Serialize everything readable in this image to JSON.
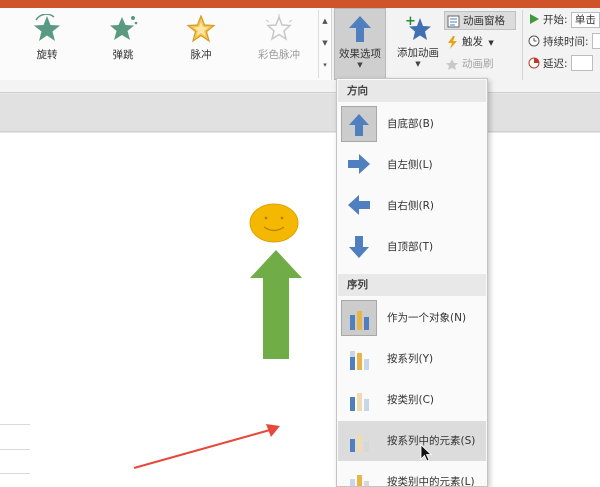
{
  "animations_gallery": [
    {
      "label": "旋转",
      "icon": "spin-star-icon"
    },
    {
      "label": "弹跳",
      "icon": "bounce-star-icon"
    },
    {
      "label": "脉冲",
      "icon": "pulse-star-icon"
    },
    {
      "label": "彩色脉冲",
      "icon": "color-pulse-star-icon"
    }
  ],
  "ribbon": {
    "effect_options_label": "效果选项",
    "add_animation_label": "添加动画",
    "animation_pane_label": "动画窗格",
    "trigger_label": "触发",
    "animation_painter_label": "动画刷",
    "start_label": "开始:",
    "start_value": "单击",
    "duration_label": "持续时间:",
    "delay_label": "延迟:"
  },
  "dropdown": {
    "direction_header": "方向",
    "direction_items": [
      {
        "label": "自底部(B)",
        "icon": "arrow-up-icon",
        "selected": true
      },
      {
        "label": "自左侧(L)",
        "icon": "arrow-right-icon",
        "selected": false
      },
      {
        "label": "自右侧(R)",
        "icon": "arrow-left-icon",
        "selected": false
      },
      {
        "label": "自顶部(T)",
        "icon": "arrow-down-icon",
        "selected": false
      }
    ],
    "sequence_header": "序列",
    "sequence_items": [
      {
        "label": "作为一个对象(N)",
        "icon": "chart-as-one-object-icon",
        "selected": true
      },
      {
        "label": "按系列(Y)",
        "icon": "chart-by-series-icon",
        "selected": false
      },
      {
        "label": "按类别(C)",
        "icon": "chart-by-category-icon",
        "selected": false
      },
      {
        "label": "按系列中的元素(S)",
        "icon": "chart-by-series-element-icon",
        "selected": false,
        "hovered": true
      },
      {
        "label": "按类别中的元素(L)",
        "icon": "chart-by-category-element-icon",
        "selected": false
      }
    ]
  },
  "colors": {
    "accent_blue": "#4f7fbf",
    "title_bar": "#d0542a",
    "smiley_fill": "#f5b800",
    "arrow_green": "#70ad47",
    "annotation_red": "#e8483a"
  }
}
